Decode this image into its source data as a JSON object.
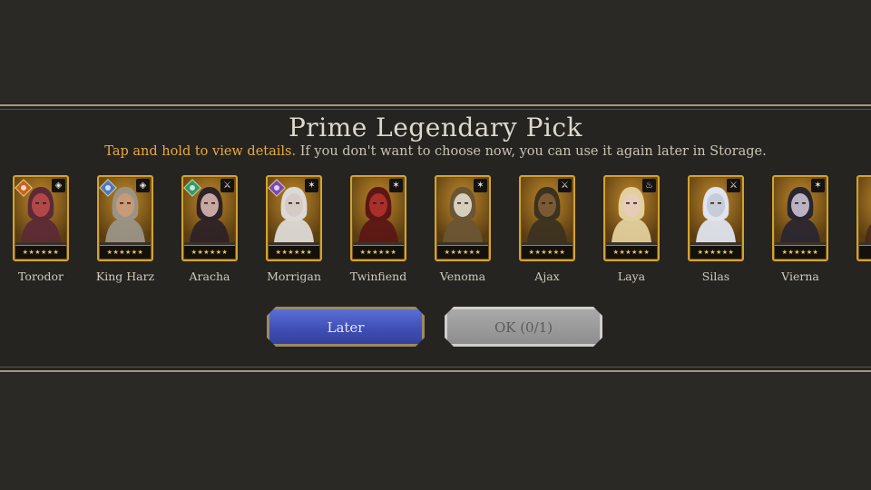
{
  "dialog": {
    "title": "Prime Legendary Pick",
    "subtitle_highlight": "Tap and hold to view details.",
    "subtitle_rest": " If you don't want to choose now, you can use it again later in Storage."
  },
  "champions": [
    {
      "name": "Torodor",
      "stars": "★★★★★★",
      "affinity": "force",
      "role_icon": "defense-icon",
      "role_glyph": "◈",
      "skin": "#b14848",
      "hair": "#5c2a36"
    },
    {
      "name": "King Harz",
      "stars": "★★★★★★",
      "affinity": "magic",
      "role_icon": "defense-icon",
      "role_glyph": "◈",
      "skin": "#c79a78",
      "hair": "#9a9487"
    },
    {
      "name": "Aracha",
      "stars": "★★★★★★",
      "affinity": "spirit",
      "role_icon": "attack-icon",
      "role_glyph": "⚔",
      "skin": "#c7a7a2",
      "hair": "#2d2226"
    },
    {
      "name": "Morrigan",
      "stars": "★★★★★★",
      "affinity": "void",
      "role_icon": "support-icon",
      "role_glyph": "✶",
      "skin": "#d6cbc6",
      "hair": "#dcdad6"
    },
    {
      "name": "Twinfiend",
      "stars": "★★★★★★",
      "affinity": "",
      "role_icon": "support-icon",
      "role_glyph": "✶",
      "skin": "#a82f2a",
      "hair": "#5c1714"
    },
    {
      "name": "Venoma",
      "stars": "★★★★★★",
      "affinity": "",
      "role_icon": "support-icon",
      "role_glyph": "✶",
      "skin": "#d7cfbd",
      "hair": "#6a5534"
    },
    {
      "name": "Ajax",
      "stars": "★★★★★★",
      "affinity": "",
      "role_icon": "attack-icon",
      "role_glyph": "⚔",
      "skin": "#7a5a34",
      "hair": "#3b3220"
    },
    {
      "name": "Laya",
      "stars": "★★★★★★",
      "affinity": "",
      "role_icon": "hp-icon",
      "role_glyph": "♨",
      "skin": "#e7cdb9",
      "hair": "#e2cf9c"
    },
    {
      "name": "Silas",
      "stars": "★★★★★★",
      "affinity": "",
      "role_icon": "attack-icon",
      "role_glyph": "⚔",
      "skin": "#c6ccd8",
      "hair": "#dfe4ee"
    },
    {
      "name": "Vierna",
      "stars": "★★★★★★",
      "affinity": "",
      "role_icon": "support-icon",
      "role_glyph": "✶",
      "skin": "#b9b2c2",
      "hair": "#2a2630"
    },
    {
      "name": "",
      "stars": "★★★",
      "affinity": "",
      "role_icon": "support-icon",
      "role_glyph": "✶",
      "skin": "#8a4a2a",
      "hair": "#4a2a1a"
    }
  ],
  "buttons": {
    "later": "Later",
    "ok": "OK (0/1)"
  }
}
